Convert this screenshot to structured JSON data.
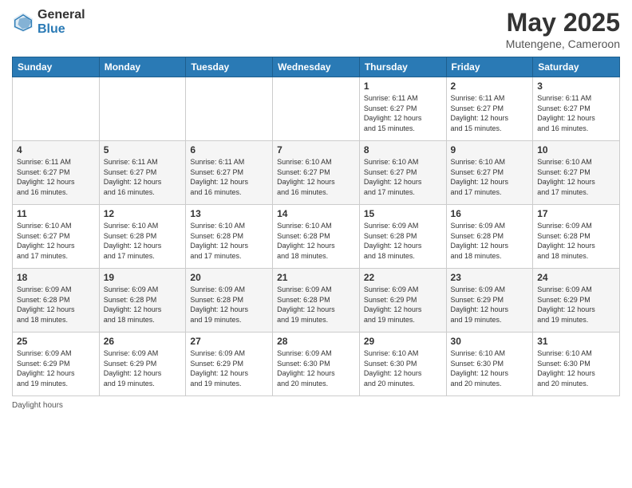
{
  "header": {
    "logo_general": "General",
    "logo_blue": "Blue",
    "title": "May 2025",
    "subtitle": "Mutengene, Cameroon"
  },
  "days_of_week": [
    "Sunday",
    "Monday",
    "Tuesday",
    "Wednesday",
    "Thursday",
    "Friday",
    "Saturday"
  ],
  "weeks": [
    [
      {
        "day": "",
        "info": ""
      },
      {
        "day": "",
        "info": ""
      },
      {
        "day": "",
        "info": ""
      },
      {
        "day": "",
        "info": ""
      },
      {
        "day": "1",
        "info": "Sunrise: 6:11 AM\nSunset: 6:27 PM\nDaylight: 12 hours\nand 15 minutes."
      },
      {
        "day": "2",
        "info": "Sunrise: 6:11 AM\nSunset: 6:27 PM\nDaylight: 12 hours\nand 15 minutes."
      },
      {
        "day": "3",
        "info": "Sunrise: 6:11 AM\nSunset: 6:27 PM\nDaylight: 12 hours\nand 16 minutes."
      }
    ],
    [
      {
        "day": "4",
        "info": "Sunrise: 6:11 AM\nSunset: 6:27 PM\nDaylight: 12 hours\nand 16 minutes."
      },
      {
        "day": "5",
        "info": "Sunrise: 6:11 AM\nSunset: 6:27 PM\nDaylight: 12 hours\nand 16 minutes."
      },
      {
        "day": "6",
        "info": "Sunrise: 6:11 AM\nSunset: 6:27 PM\nDaylight: 12 hours\nand 16 minutes."
      },
      {
        "day": "7",
        "info": "Sunrise: 6:10 AM\nSunset: 6:27 PM\nDaylight: 12 hours\nand 16 minutes."
      },
      {
        "day": "8",
        "info": "Sunrise: 6:10 AM\nSunset: 6:27 PM\nDaylight: 12 hours\nand 17 minutes."
      },
      {
        "day": "9",
        "info": "Sunrise: 6:10 AM\nSunset: 6:27 PM\nDaylight: 12 hours\nand 17 minutes."
      },
      {
        "day": "10",
        "info": "Sunrise: 6:10 AM\nSunset: 6:27 PM\nDaylight: 12 hours\nand 17 minutes."
      }
    ],
    [
      {
        "day": "11",
        "info": "Sunrise: 6:10 AM\nSunset: 6:27 PM\nDaylight: 12 hours\nand 17 minutes."
      },
      {
        "day": "12",
        "info": "Sunrise: 6:10 AM\nSunset: 6:28 PM\nDaylight: 12 hours\nand 17 minutes."
      },
      {
        "day": "13",
        "info": "Sunrise: 6:10 AM\nSunset: 6:28 PM\nDaylight: 12 hours\nand 17 minutes."
      },
      {
        "day": "14",
        "info": "Sunrise: 6:10 AM\nSunset: 6:28 PM\nDaylight: 12 hours\nand 18 minutes."
      },
      {
        "day": "15",
        "info": "Sunrise: 6:09 AM\nSunset: 6:28 PM\nDaylight: 12 hours\nand 18 minutes."
      },
      {
        "day": "16",
        "info": "Sunrise: 6:09 AM\nSunset: 6:28 PM\nDaylight: 12 hours\nand 18 minutes."
      },
      {
        "day": "17",
        "info": "Sunrise: 6:09 AM\nSunset: 6:28 PM\nDaylight: 12 hours\nand 18 minutes."
      }
    ],
    [
      {
        "day": "18",
        "info": "Sunrise: 6:09 AM\nSunset: 6:28 PM\nDaylight: 12 hours\nand 18 minutes."
      },
      {
        "day": "19",
        "info": "Sunrise: 6:09 AM\nSunset: 6:28 PM\nDaylight: 12 hours\nand 18 minutes."
      },
      {
        "day": "20",
        "info": "Sunrise: 6:09 AM\nSunset: 6:28 PM\nDaylight: 12 hours\nand 19 minutes."
      },
      {
        "day": "21",
        "info": "Sunrise: 6:09 AM\nSunset: 6:28 PM\nDaylight: 12 hours\nand 19 minutes."
      },
      {
        "day": "22",
        "info": "Sunrise: 6:09 AM\nSunset: 6:29 PM\nDaylight: 12 hours\nand 19 minutes."
      },
      {
        "day": "23",
        "info": "Sunrise: 6:09 AM\nSunset: 6:29 PM\nDaylight: 12 hours\nand 19 minutes."
      },
      {
        "day": "24",
        "info": "Sunrise: 6:09 AM\nSunset: 6:29 PM\nDaylight: 12 hours\nand 19 minutes."
      }
    ],
    [
      {
        "day": "25",
        "info": "Sunrise: 6:09 AM\nSunset: 6:29 PM\nDaylight: 12 hours\nand 19 minutes."
      },
      {
        "day": "26",
        "info": "Sunrise: 6:09 AM\nSunset: 6:29 PM\nDaylight: 12 hours\nand 19 minutes."
      },
      {
        "day": "27",
        "info": "Sunrise: 6:09 AM\nSunset: 6:29 PM\nDaylight: 12 hours\nand 19 minutes."
      },
      {
        "day": "28",
        "info": "Sunrise: 6:09 AM\nSunset: 6:30 PM\nDaylight: 12 hours\nand 20 minutes."
      },
      {
        "day": "29",
        "info": "Sunrise: 6:10 AM\nSunset: 6:30 PM\nDaylight: 12 hours\nand 20 minutes."
      },
      {
        "day": "30",
        "info": "Sunrise: 6:10 AM\nSunset: 6:30 PM\nDaylight: 12 hours\nand 20 minutes."
      },
      {
        "day": "31",
        "info": "Sunrise: 6:10 AM\nSunset: 6:30 PM\nDaylight: 12 hours\nand 20 minutes."
      }
    ]
  ],
  "footer": {
    "daylight_label": "Daylight hours"
  }
}
